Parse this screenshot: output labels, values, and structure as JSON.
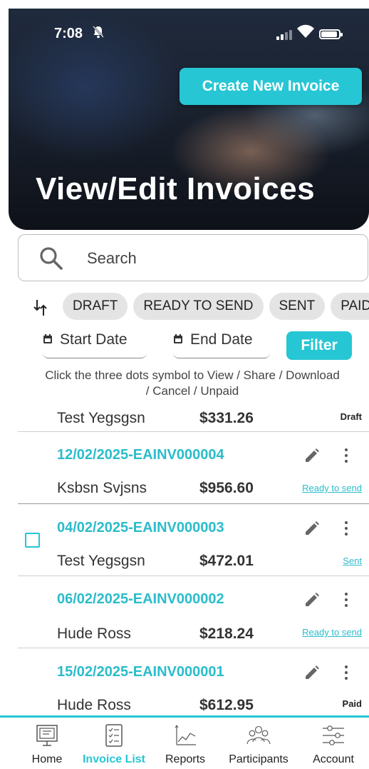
{
  "status_bar": {
    "time": "7:08"
  },
  "header": {
    "create_button_label": "Create New Invoice",
    "title": "View/Edit Invoices"
  },
  "search": {
    "placeholder": "Search"
  },
  "filters": {
    "chips": [
      "DRAFT",
      "READY TO SEND",
      "SENT",
      "PAID"
    ],
    "start_date_label": "Start Date",
    "end_date_label": "End Date",
    "filter_button_label": "Filter",
    "hint": "Click the three dots symbol to View / Share / Download / Cancel / Unpaid"
  },
  "invoices": [
    {
      "number": "",
      "customer": "Test Yegsgsn",
      "amount": "$331.26",
      "status": "Draft",
      "status_style": "plain"
    },
    {
      "number": "12/02/2025-EAINV000004",
      "customer": "Ksbsn Svjsns",
      "amount": "$956.60",
      "status": "Ready to send",
      "status_style": "link"
    },
    {
      "number": "04/02/2025-EAINV000003",
      "customer": "Test Yegsgsn",
      "amount": "$472.01",
      "status": "Sent",
      "status_style": "link"
    },
    {
      "number": "06/02/2025-EAINV000002",
      "customer": "Hude Ross",
      "amount": "$218.24",
      "status": "Ready to send",
      "status_style": "link"
    },
    {
      "number": "15/02/2025-EAINV000001",
      "customer": "Hude Ross",
      "amount": "$612.95",
      "status": "Paid",
      "status_style": "plain"
    }
  ],
  "bottom_nav": [
    {
      "label": "Home",
      "icon": "home-monitor-icon",
      "active": false
    },
    {
      "label": "Invoice List",
      "icon": "checklist-icon",
      "active": true
    },
    {
      "label": "Reports",
      "icon": "line-chart-icon",
      "active": false
    },
    {
      "label": "Participants",
      "icon": "people-icon",
      "active": false
    },
    {
      "label": "Account",
      "icon": "sliders-icon",
      "active": false
    }
  ],
  "colors": {
    "accent": "#27c6d4",
    "link": "#2bbccb"
  }
}
